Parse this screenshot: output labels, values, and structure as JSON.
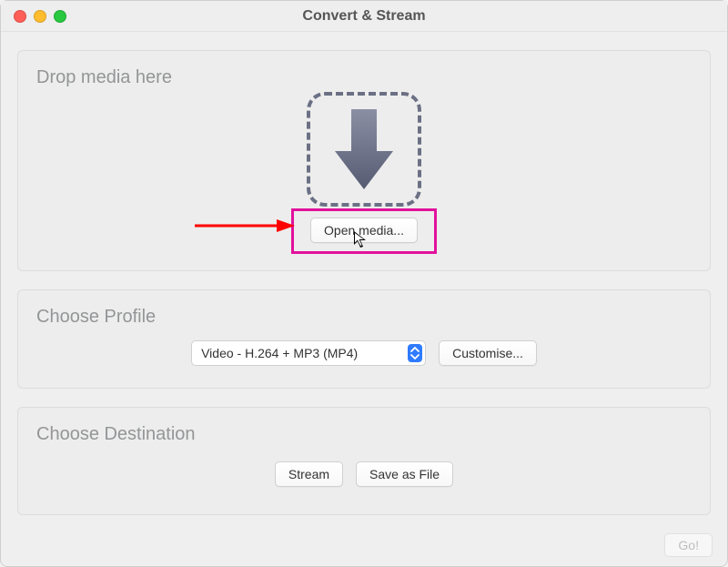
{
  "window": {
    "title": "Convert & Stream"
  },
  "colors": {
    "close": "#ff5f57",
    "minimize": "#febc2e",
    "zoom": "#28c840",
    "highlight": "#e1129c",
    "arrow_red": "#ff0000",
    "down_arrow": "#6b7084",
    "select_accent": "#2f7bff"
  },
  "drop": {
    "title": "Drop media here",
    "open_media_label": "Open media..."
  },
  "profile": {
    "title": "Choose Profile",
    "selected": "Video - H.264 + MP3 (MP4)",
    "customise_label": "Customise..."
  },
  "destination": {
    "title": "Choose Destination",
    "stream_label": "Stream",
    "save_label": "Save as File"
  },
  "go_label": "Go!"
}
